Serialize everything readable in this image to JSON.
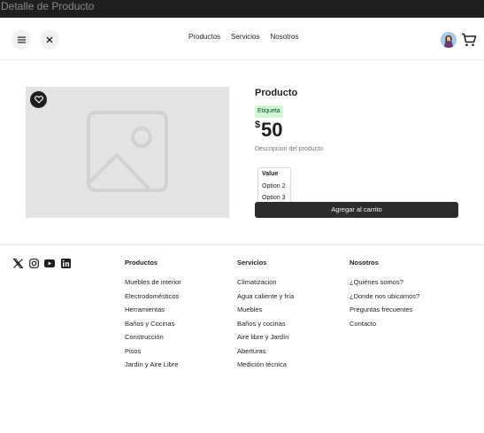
{
  "window": {
    "title": "Detalle de Producto"
  },
  "header": {
    "nav": [
      "Productos",
      "Servicios",
      "Nosotros"
    ]
  },
  "product": {
    "title": "Producto",
    "tag": "Etiqueta",
    "currency": "$",
    "price": "50",
    "description": "Descripcion del producto",
    "select": {
      "selected": "Value",
      "options": [
        "Option 2",
        "Option 3"
      ]
    },
    "add_to_cart": "Agregar al carrito"
  },
  "footer": {
    "social": [
      "x-icon",
      "instagram-icon",
      "youtube-icon",
      "linkedin-icon"
    ],
    "columns": [
      {
        "title": "Productos",
        "links": [
          "Muebles de interior",
          "Electrodomésticos",
          "Herramientas",
          "Baños y Cocinas",
          "Construcción",
          "Pisos",
          "Jardín y Aire Libre"
        ]
      },
      {
        "title": "Servicios",
        "links": [
          "Climatizacion",
          "Agua caliente y fría",
          "Muebles",
          "Baños y cocinas",
          "Aire libre y Jardín",
          "Aberturas",
          "Medición técnica"
        ]
      },
      {
        "title": "Nosotros",
        "links": [
          "¿Quiénes somos?",
          "¿Donde nos ubicamos?",
          "Preguntas frecuentes",
          "Contacto"
        ]
      }
    ]
  }
}
